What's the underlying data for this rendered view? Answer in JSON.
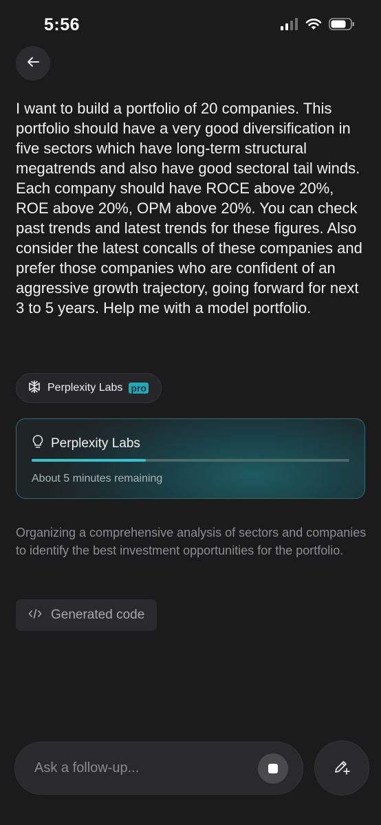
{
  "status_bar": {
    "time": "5:56",
    "icons": [
      "signal-icon",
      "wifi-icon",
      "battery-icon"
    ]
  },
  "nav": {
    "back_icon": "arrow-left-icon"
  },
  "query": {
    "text": "I want to build a portfolio of 20 companies. This portfolio should have a very good diversification in five sectors which have long-term structural megatrends and also have good sectoral tail winds. Each company should have ROCE above 20%, ROE above 20%, OPM above 20%. You can check past trends and latest trends for these figures. Also consider the latest concalls of these companies and prefer those companies who are confident of an aggressive growth trajectory, going forward for next 3 to 5 years. Help me with a model portfolio."
  },
  "labs_chip": {
    "icon": "labs-icon",
    "label": "Perplexity Labs",
    "badge": "pro"
  },
  "progress_card": {
    "icon": "lightbulb-icon",
    "title": "Perplexity Labs",
    "progress": 0.36,
    "remaining": "About 5 minutes remaining"
  },
  "status_text": "Organizing a comprehensive analysis of sectors and companies to identify the best investment opportunities for the portfolio.",
  "generated_code": {
    "icon": "code-icon",
    "label": "Generated code"
  },
  "followup": {
    "placeholder": "Ask a follow-up...",
    "value": "",
    "stop_icon": "stop-icon",
    "new_thread_icon": "edit-plus-icon"
  },
  "colors": {
    "background": "#1b1b1c",
    "accent": "#2ec4d0",
    "pro_badge": "#22a9b7"
  }
}
